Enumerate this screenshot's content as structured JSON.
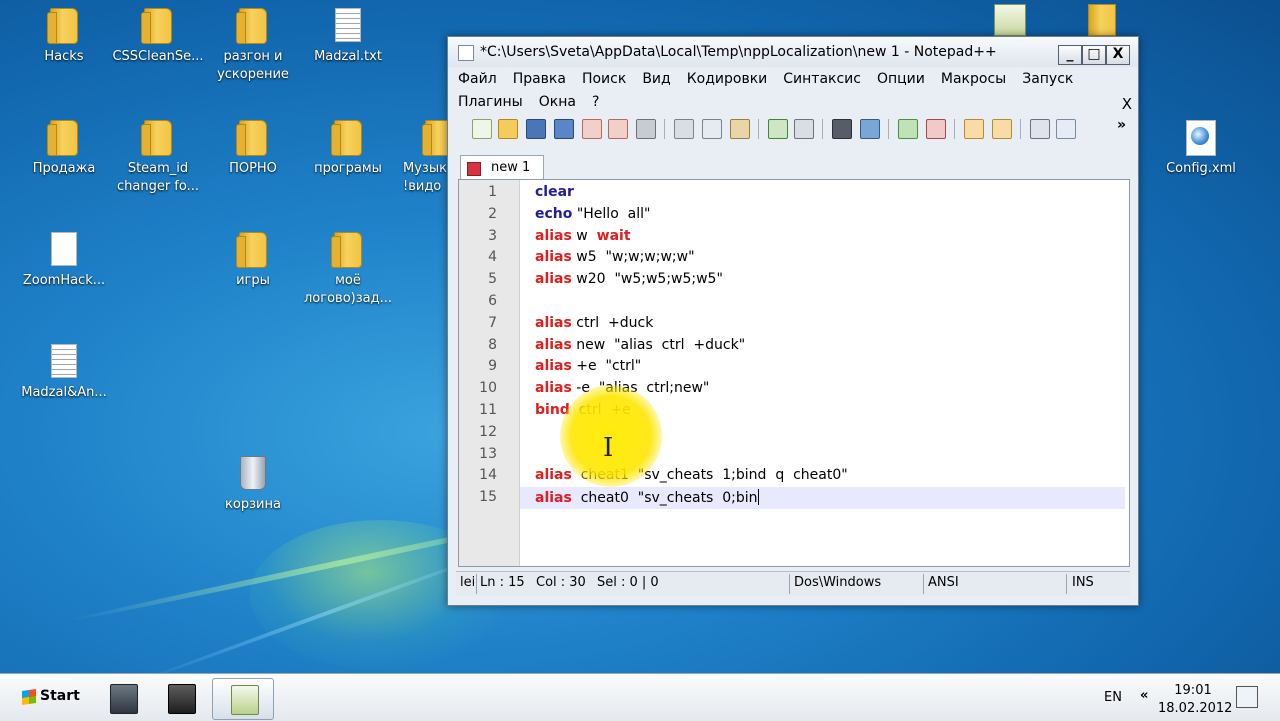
{
  "desktop": {
    "icons": [
      {
        "label": "Hacks",
        "type": "folder"
      },
      {
        "label": "CSSCleanSe...",
        "type": "folder"
      },
      {
        "label": "разгон и ускорение",
        "type": "folder"
      },
      {
        "label": "Madzal.txt",
        "type": "text-file"
      },
      {
        "label": "Продажа",
        "type": "folder"
      },
      {
        "label": "Steam_id changer fo...",
        "type": "folder"
      },
      {
        "label": "ПОРНО",
        "type": "folder"
      },
      {
        "label": "програмы",
        "type": "folder"
      },
      {
        "label": "Музык !видо",
        "type": "folder"
      },
      {
        "label": "ZoomHack...",
        "type": "file"
      },
      {
        "label": "игры",
        "type": "folder"
      },
      {
        "label": "моё логово)зад...",
        "type": "folder"
      },
      {
        "label": "Madzal&An...",
        "type": "text-file"
      },
      {
        "label": "корзина",
        "type": "recycle-bin"
      },
      {
        "label": "Config.xml",
        "type": "xml-file"
      }
    ]
  },
  "window": {
    "title": "*C:\\Users\\Sveta\\AppData\\Local\\Temp\\nppLocalization\\new  1 - Notepad++",
    "minimize_label": "_",
    "maximize_label": "□",
    "close_label": "X",
    "menu_row1": [
      "Файл",
      "Правка",
      "Поиск",
      "Вид",
      "Кодировки",
      "Синтаксис",
      "Опции",
      "Макросы",
      "Запуск"
    ],
    "menu_row2": [
      "Плагины",
      "Окна",
      "?"
    ],
    "mdi_close": "X",
    "toolbar_more": "»",
    "tab_label": "new 1"
  },
  "editor": {
    "line_numbers": [
      "1",
      "2",
      "3",
      "4",
      "5",
      "6",
      "7",
      "8",
      "9",
      "10",
      "11",
      "12",
      "13",
      "14",
      "15"
    ],
    "lines": [
      [
        {
          "t": "clear",
          "c": "kw-blue"
        }
      ],
      [
        {
          "t": "echo",
          "c": "kw-blue"
        },
        {
          "t": " \"Hello  all\"",
          "c": ""
        }
      ],
      [
        {
          "t": "alias",
          "c": "kw-red"
        },
        {
          "t": " w  ",
          "c": ""
        },
        {
          "t": "wait",
          "c": "kw-red"
        }
      ],
      [
        {
          "t": "alias",
          "c": "kw-red"
        },
        {
          "t": " w5  \"w;w;w;w;w\"",
          "c": ""
        }
      ],
      [
        {
          "t": "alias",
          "c": "kw-red"
        },
        {
          "t": " w20  \"w5;w5;w5;w5\"",
          "c": ""
        }
      ],
      [],
      [
        {
          "t": "alias",
          "c": "kw-red"
        },
        {
          "t": " ctrl  +duck",
          "c": ""
        }
      ],
      [
        {
          "t": "alias",
          "c": "kw-red"
        },
        {
          "t": " new  \"alias  ctrl  +duck\"",
          "c": ""
        }
      ],
      [
        {
          "t": "alias",
          "c": "kw-red"
        },
        {
          "t": " +e  \"ctrl\"",
          "c": ""
        }
      ],
      [
        {
          "t": "alias",
          "c": "kw-red"
        },
        {
          "t": " -e  \"alias  ctrl;new\"",
          "c": ""
        }
      ],
      [
        {
          "t": "bind",
          "c": "kw-red"
        },
        {
          "t": "  ctrl  +e",
          "c": ""
        }
      ],
      [],
      [],
      [
        {
          "t": "alias",
          "c": "kw-red"
        },
        {
          "t": "  cheat1  \"sv_cheats  1;bind  q  cheat0\"",
          "c": ""
        }
      ],
      [
        {
          "t": "alias",
          "c": "kw-red"
        },
        {
          "t": "  cheat0  \"sv_cheats  0;bin",
          "c": ""
        }
      ]
    ]
  },
  "statusbar": {
    "cut_label": "lei",
    "ln": "Ln : 15",
    "col": "Col : 30",
    "sel": "Sel : 0 | 0",
    "eol": "Dos\\Windows",
    "encoding": "ANSI",
    "mode": "INS"
  },
  "taskbar": {
    "start_label": "Start",
    "lang": "EN",
    "chevron": "«",
    "time": "19:01",
    "date": "18.02.2012"
  },
  "colors": {
    "keyword_blue": "#1d1d9e",
    "keyword_red": "#e11d1d",
    "cursor_highlight": "#ffe600"
  }
}
